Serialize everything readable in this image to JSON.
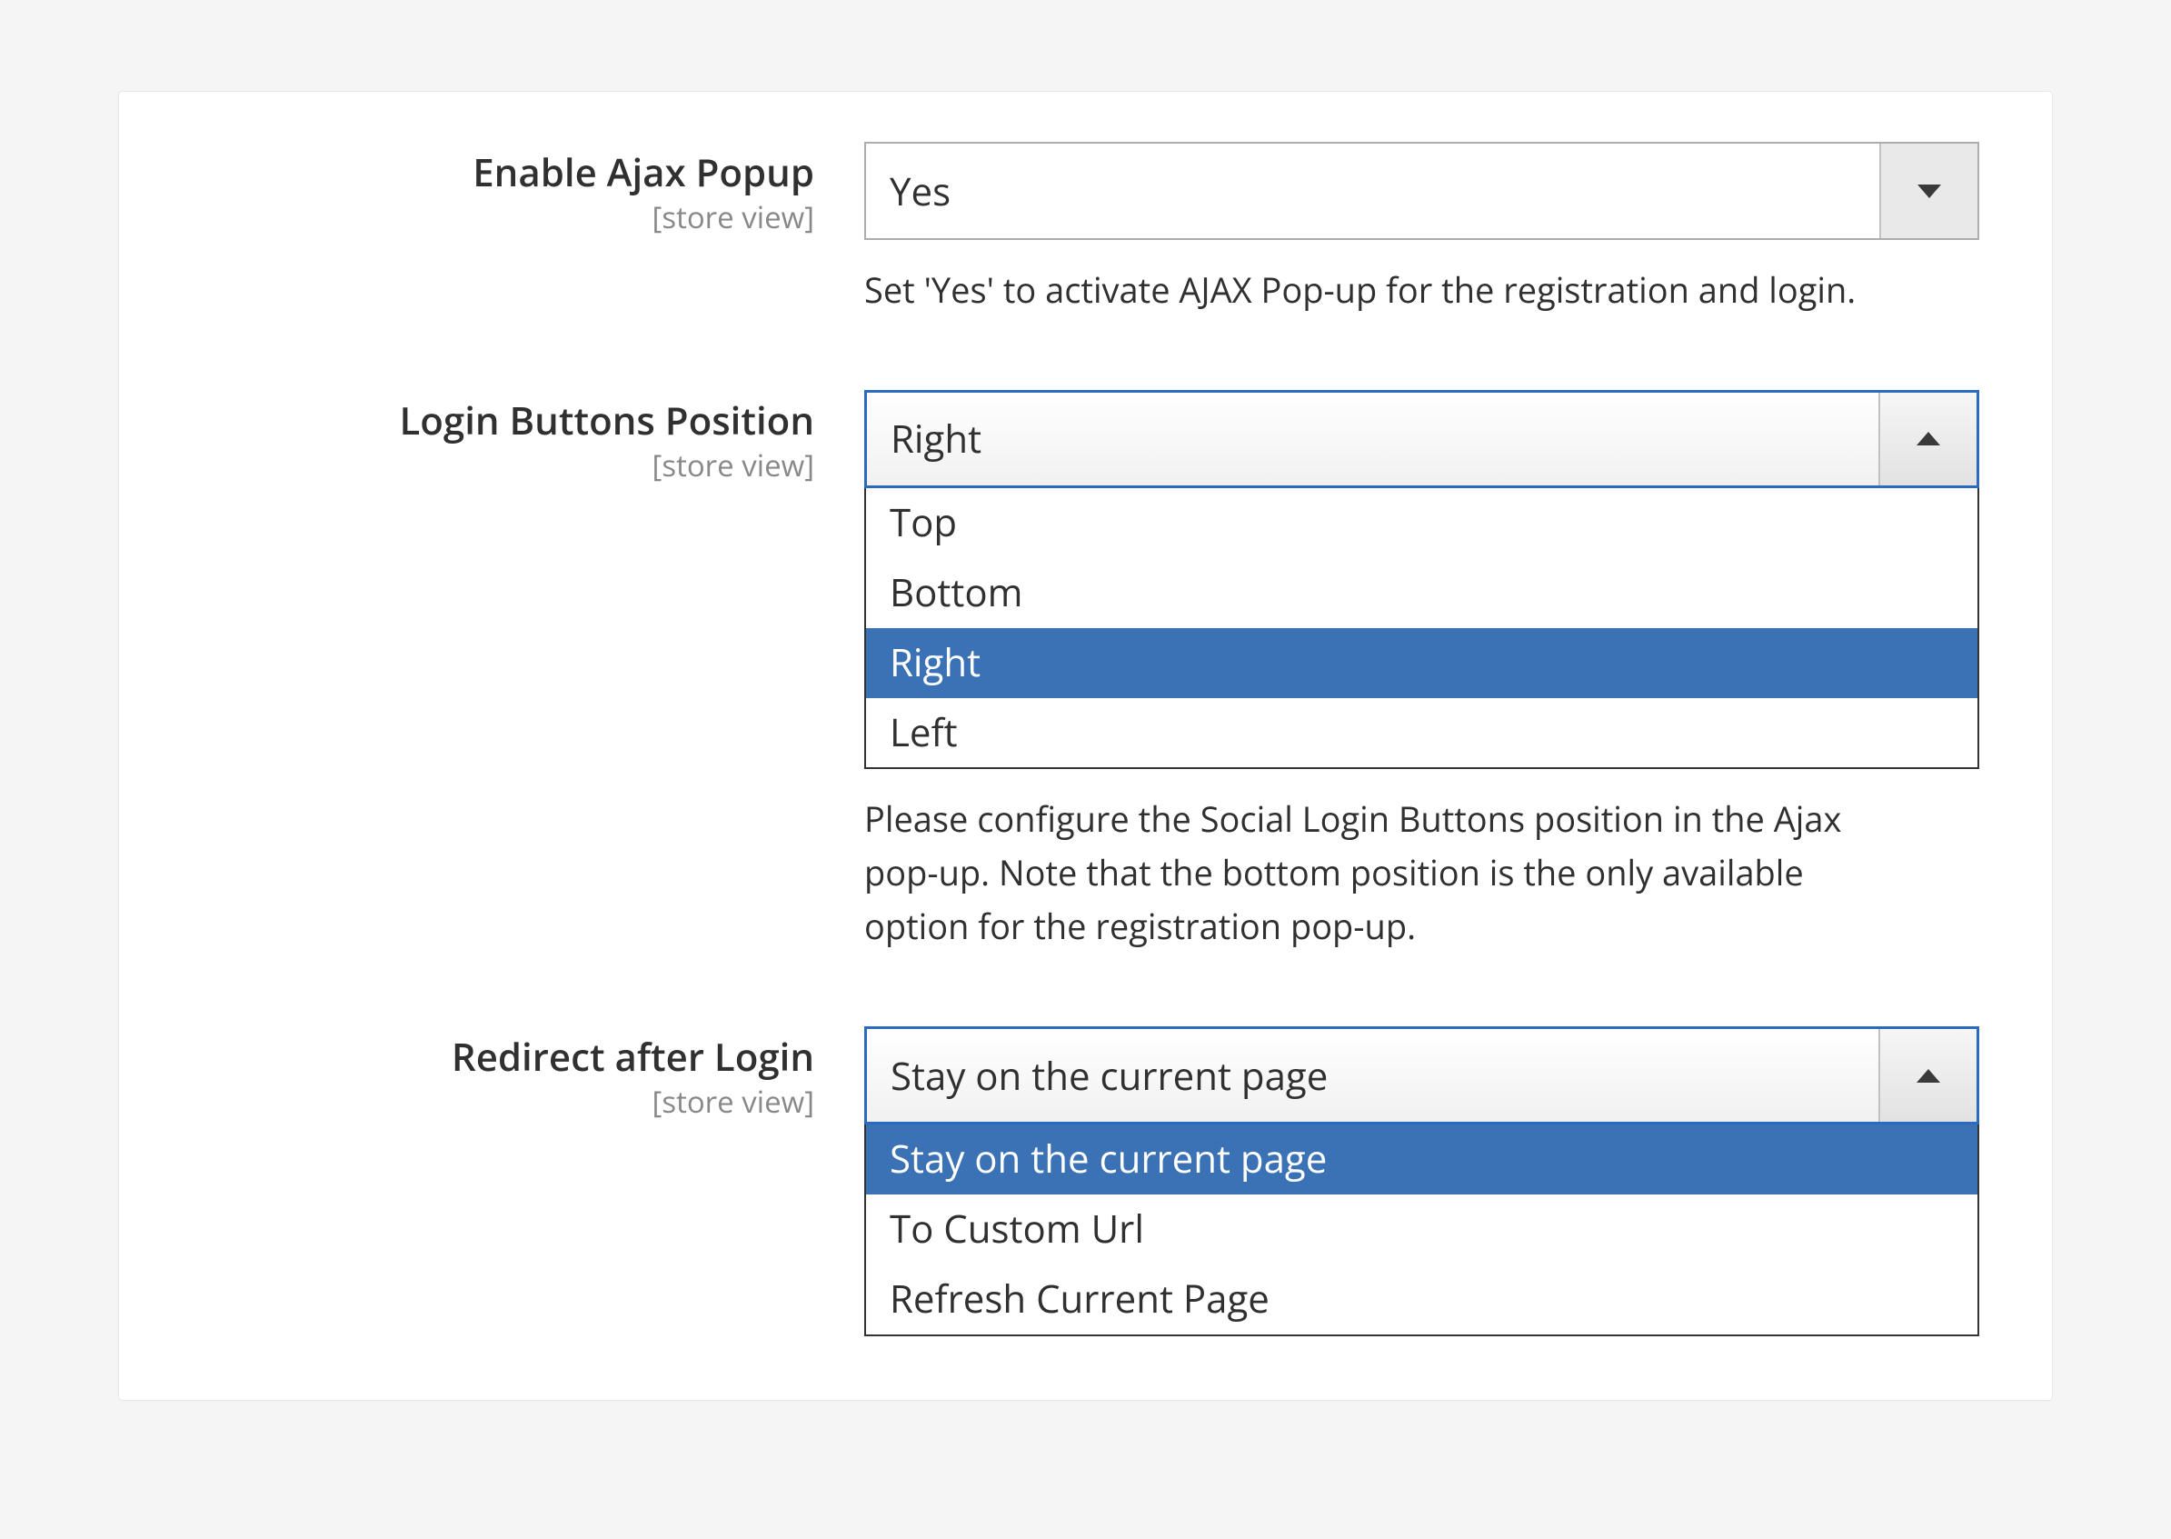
{
  "scope_text": "[store view]",
  "ajax": {
    "label": "Enable Ajax Popup",
    "value": "Yes",
    "help": "Set 'Yes' to activate AJAX Pop-up for the registration and login."
  },
  "position": {
    "label": "Login Buttons Position",
    "value": "Right",
    "options": [
      "Top",
      "Bottom",
      "Right",
      "Left"
    ],
    "selected_index": 2,
    "help": "Please configure the Social Login Buttons position in the Ajax pop-up. Note that the bottom position is the only available option for the registration pop-up."
  },
  "redirect": {
    "label": "Redirect after Login",
    "value": "Stay on the current page",
    "options": [
      "Stay on the current page",
      "To Custom Url",
      "Refresh Current Page"
    ],
    "selected_index": 0
  }
}
